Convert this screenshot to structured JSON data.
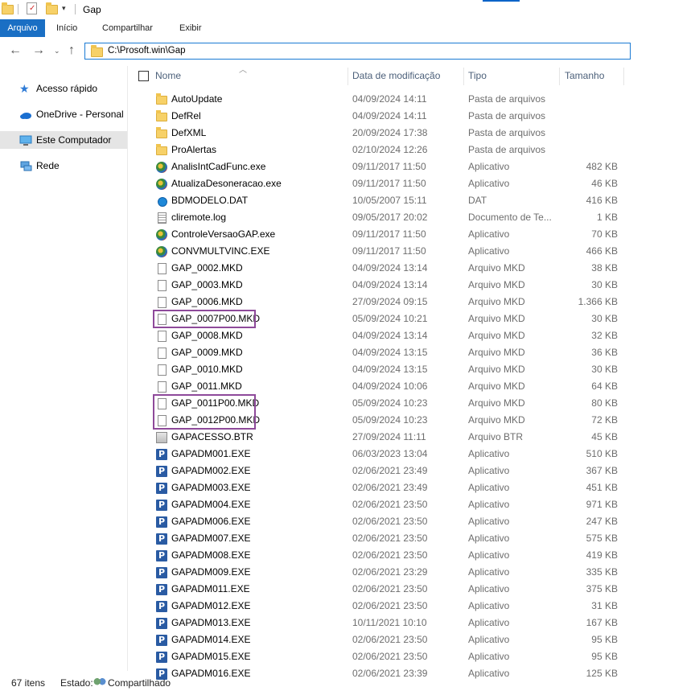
{
  "window": {
    "title": "Gap"
  },
  "ribbon": {
    "tabs": [
      "Arquivo",
      "Início",
      "Compartilhar",
      "Exibir"
    ]
  },
  "address": {
    "path": "C:\\Prosoft.win\\Gap"
  },
  "nav": {
    "items": [
      {
        "label": "Acesso rápido",
        "icon": "star-icon"
      },
      {
        "label": "OneDrive - Personal",
        "icon": "cloud-icon"
      },
      {
        "label": "Este Computador",
        "icon": "computer-icon",
        "selected": true
      },
      {
        "label": "Rede",
        "icon": "network-icon"
      }
    ]
  },
  "columns": {
    "name": "Nome",
    "date": "Data de modificação",
    "type": "Tipo",
    "size": "Tamanho"
  },
  "files": [
    {
      "name": "AutoUpdate",
      "date": "04/09/2024 14:11",
      "type": "Pasta de arquivos",
      "size": "",
      "icon": "folder"
    },
    {
      "name": "DefRel",
      "date": "04/09/2024 14:11",
      "type": "Pasta de arquivos",
      "size": "",
      "icon": "folder"
    },
    {
      "name": "DefXML",
      "date": "20/09/2024 17:38",
      "type": "Pasta de arquivos",
      "size": "",
      "icon": "folder"
    },
    {
      "name": "ProAlertas",
      "date": "02/10/2024 12:26",
      "type": "Pasta de arquivos",
      "size": "",
      "icon": "folder"
    },
    {
      "name": "AnalisIntCadFunc.exe",
      "date": "09/11/2017 11:50",
      "type": "Aplicativo",
      "size": "482 KB",
      "icon": "exe"
    },
    {
      "name": "AtualizaDesoneracao.exe",
      "date": "09/11/2017 11:50",
      "type": "Aplicativo",
      "size": "46 KB",
      "icon": "exe"
    },
    {
      "name": "BDMODELO.DAT",
      "date": "10/05/2007 15:11",
      "type": "DAT",
      "size": "416 KB",
      "icon": "dat"
    },
    {
      "name": "cliremote.log",
      "date": "09/05/2017 20:02",
      "type": "Documento de Te...",
      "size": "1 KB",
      "icon": "log"
    },
    {
      "name": "ControleVersaoGAP.exe",
      "date": "09/11/2017 11:50",
      "type": "Aplicativo",
      "size": "70 KB",
      "icon": "exe"
    },
    {
      "name": "CONVMULTVINC.EXE",
      "date": "09/11/2017 11:50",
      "type": "Aplicativo",
      "size": "466 KB",
      "icon": "exe"
    },
    {
      "name": "GAP_0002.MKD",
      "date": "04/09/2024 13:14",
      "type": "Arquivo MKD",
      "size": "38 KB",
      "icon": "doc"
    },
    {
      "name": "GAP_0003.MKD",
      "date": "04/09/2024 13:14",
      "type": "Arquivo MKD",
      "size": "30 KB",
      "icon": "doc"
    },
    {
      "name": "GAP_0006.MKD",
      "date": "27/09/2024 09:15",
      "type": "Arquivo MKD",
      "size": "1.366 KB",
      "icon": "doc"
    },
    {
      "name": "GAP_0007P00.MKD",
      "date": "05/09/2024 10:21",
      "type": "Arquivo MKD",
      "size": "30 KB",
      "icon": "doc"
    },
    {
      "name": "GAP_0008.MKD",
      "date": "04/09/2024 13:14",
      "type": "Arquivo MKD",
      "size": "32 KB",
      "icon": "doc"
    },
    {
      "name": "GAP_0009.MKD",
      "date": "04/09/2024 13:15",
      "type": "Arquivo MKD",
      "size": "36 KB",
      "icon": "doc"
    },
    {
      "name": "GAP_0010.MKD",
      "date": "04/09/2024 13:15",
      "type": "Arquivo MKD",
      "size": "30 KB",
      "icon": "doc"
    },
    {
      "name": "GAP_0011.MKD",
      "date": "04/09/2024 10:06",
      "type": "Arquivo MKD",
      "size": "64 KB",
      "icon": "doc"
    },
    {
      "name": "GAP_0011P00.MKD",
      "date": "05/09/2024 10:23",
      "type": "Arquivo MKD",
      "size": "80 KB",
      "icon": "doc"
    },
    {
      "name": "GAP_0012P00.MKD",
      "date": "05/09/2024 10:23",
      "type": "Arquivo MKD",
      "size": "72 KB",
      "icon": "doc"
    },
    {
      "name": "GAPACESSO.BTR",
      "date": "27/09/2024 11:11",
      "type": "Arquivo BTR",
      "size": "45 KB",
      "icon": "btr"
    },
    {
      "name": "GAPADM001.EXE",
      "date": "06/03/2023 13:04",
      "type": "Aplicativo",
      "size": "510 KB",
      "icon": "gapp"
    },
    {
      "name": "GAPADM002.EXE",
      "date": "02/06/2021 23:49",
      "type": "Aplicativo",
      "size": "367 KB",
      "icon": "gapp"
    },
    {
      "name": "GAPADM003.EXE",
      "date": "02/06/2021 23:49",
      "type": "Aplicativo",
      "size": "451 KB",
      "icon": "gapp"
    },
    {
      "name": "GAPADM004.EXE",
      "date": "02/06/2021 23:50",
      "type": "Aplicativo",
      "size": "971 KB",
      "icon": "gapp"
    },
    {
      "name": "GAPADM006.EXE",
      "date": "02/06/2021 23:50",
      "type": "Aplicativo",
      "size": "247 KB",
      "icon": "gapp"
    },
    {
      "name": "GAPADM007.EXE",
      "date": "02/06/2021 23:50",
      "type": "Aplicativo",
      "size": "575 KB",
      "icon": "gapp"
    },
    {
      "name": "GAPADM008.EXE",
      "date": "02/06/2021 23:50",
      "type": "Aplicativo",
      "size": "419 KB",
      "icon": "gapp"
    },
    {
      "name": "GAPADM009.EXE",
      "date": "02/06/2021 23:29",
      "type": "Aplicativo",
      "size": "335 KB",
      "icon": "gapp"
    },
    {
      "name": "GAPADM011.EXE",
      "date": "02/06/2021 23:50",
      "type": "Aplicativo",
      "size": "375 KB",
      "icon": "gapp"
    },
    {
      "name": "GAPADM012.EXE",
      "date": "02/06/2021 23:50",
      "type": "Aplicativo",
      "size": "31 KB",
      "icon": "gapp"
    },
    {
      "name": "GAPADM013.EXE",
      "date": "10/11/2021 10:10",
      "type": "Aplicativo",
      "size": "167 KB",
      "icon": "gapp"
    },
    {
      "name": "GAPADM014.EXE",
      "date": "02/06/2021 23:50",
      "type": "Aplicativo",
      "size": "95 KB",
      "icon": "gapp"
    },
    {
      "name": "GAPADM015.EXE",
      "date": "02/06/2021 23:50",
      "type": "Aplicativo",
      "size": "95 KB",
      "icon": "gapp"
    },
    {
      "name": "GAPADM016.EXE",
      "date": "02/06/2021 23:39",
      "type": "Aplicativo",
      "size": "125 KB",
      "icon": "gapp"
    }
  ],
  "highlighted": [
    "GAP_0007P00.MKD",
    "GAP_0011P00.MKD",
    "GAP_0012P00.MKD"
  ],
  "status": {
    "count": "67 itens",
    "state_label": "Estado:",
    "state_value": "Compartilhado"
  },
  "colors": {
    "accent": "#1a6fc4",
    "highlight_box": "#8e4a9a"
  }
}
